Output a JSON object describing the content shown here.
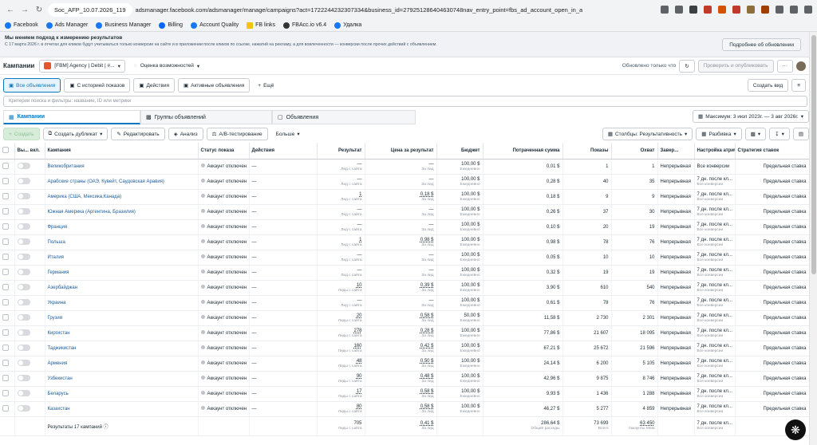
{
  "browser": {
    "tab_title": "Soc_AFP_10.07.2026_119",
    "url": "adsmanager.facebook.com/adsmanager/manage/campaigns?act=1722244232307334&business_id=279251286404630748nav_entry_point=fbs_ad_account_open_in_ads_manager_butto..."
  },
  "bookmarks": [
    "Facebook",
    "Ads Manager",
    "Business Manager",
    "Billing",
    "Account Quality",
    "FB links",
    "FBAcc.io v6.4",
    "Удалка"
  ],
  "notice": {
    "title": "Мы меняем подход к измерению результатов",
    "text": "С 17 марта 2026 г. в отчетах для кликов будут учитываться только конверсии на сайте и в приложении после кликов по ссылке, нажатий на рекламу, а для вовлеченности — конверсии после прочих действий с объявлением.",
    "button": "Подробнее об обновлении"
  },
  "header": {
    "title": "Кампании",
    "account": "[FBM] Agency | Debit | #...",
    "opportunity": "Оценка возможностей",
    "updated": "Обновлено только что",
    "review_publish": "Проверить и опубликовать",
    "more": "···"
  },
  "filters": {
    "all_ads": "Все объявления",
    "history": "С историей показов",
    "actions": "Действия",
    "active": "Активные объявления",
    "more": "Ещё",
    "create_view": "Создать вид"
  },
  "search": {
    "placeholder": "Критерии поиска и фильтры: название, ID или метрики"
  },
  "level_tabs": {
    "campaigns": "Кампании",
    "adsets": "Группы объявлений",
    "ads": "Объявления",
    "date_range": "Максимум: 3 июл 2023г. — 3 авг 2026г."
  },
  "actions": {
    "create": "Создать",
    "duplicate": "Создать дубликат",
    "edit": "Редактировать",
    "analysis": "Анализ",
    "ab_test": "A/B-тестирование",
    "more": "Больше",
    "columns": "Столбцы: Результативность",
    "breakdown": "Разбивка"
  },
  "columns": {
    "onoff": "Вы... вкл.",
    "campaign": "Кампания",
    "status": "Статус показа",
    "actions": "Действия",
    "results": "Результат",
    "cost_per_result": "Цена за результат",
    "budget": "Бюджет",
    "spent": "Потраченная сумма",
    "impressions": "Показы",
    "reach": "Охват",
    "end": "Завер...",
    "attribution": "Настройка атрибуции",
    "bid": "Стратегия ставок"
  },
  "labels": {
    "status": "Аккаунт отключен",
    "results_sub": "Лид с сайта",
    "results_sub_plural": "Лиды с сайта",
    "cpr_sub": "За лид",
    "budget_sub": "Ежедневно",
    "end_val": "Непрерывная",
    "attr_sub": "Все конверсии",
    "bid_val": "Предельная ставка",
    "attr_val": "7 дн. после кл..."
  },
  "rows": [
    {
      "name": "Великобритания",
      "results": "—",
      "cpr": "—",
      "budget": "100,00 $",
      "spent": "0,01 $",
      "imp": "1",
      "reach": "1",
      "attr": "Все конверсии"
    },
    {
      "name": "Арабские страны (ОАЭ, Кувейт, Саудовская Аравия)",
      "results": "—",
      "cpr": "—",
      "budget": "100,00 $",
      "spent": "0,28 $",
      "imp": "40",
      "reach": "35",
      "attr": "7 дн. после кл..."
    },
    {
      "name": "Америка (США, Мексика,Канада)",
      "results": "1",
      "cpr": "0,18 $",
      "budget": "100,00 $",
      "spent": "0,18 $",
      "imp": "9",
      "reach": "9",
      "attr": "7 дн. после кл..."
    },
    {
      "name": "Южная Америка (Аргентина, Бразилия)",
      "results": "—",
      "cpr": "—",
      "budget": "100,00 $",
      "spent": "0,26 $",
      "imp": "37",
      "reach": "30",
      "attr": "7 дн. после кл..."
    },
    {
      "name": "Франция",
      "results": "—",
      "cpr": "—",
      "budget": "100,00 $",
      "spent": "0,10 $",
      "imp": "20",
      "reach": "19",
      "attr": "7 дн. после кл..."
    },
    {
      "name": "Польша",
      "results": "1",
      "cpr": "0,98 $",
      "budget": "100,00 $",
      "spent": "0,98 $",
      "imp": "78",
      "reach": "76",
      "attr": "7 дн. после кл..."
    },
    {
      "name": "Италия",
      "results": "—",
      "cpr": "—",
      "budget": "100,00 $",
      "spent": "0,05 $",
      "imp": "10",
      "reach": "10",
      "attr": "7 дн. после кл..."
    },
    {
      "name": "Германия",
      "results": "—",
      "cpr": "—",
      "budget": "100,00 $",
      "spent": "0,32 $",
      "imp": "19",
      "reach": "19",
      "attr": "7 дн. после кл..."
    },
    {
      "name": "Азербайджан",
      "results": "10",
      "cpr": "0,39 $",
      "budget": "100,00 $",
      "spent": "3,90 $",
      "imp": "610",
      "reach": "540",
      "attr": "7 дн. после кл..."
    },
    {
      "name": "Украина",
      "results": "—",
      "cpr": "—",
      "budget": "100,00 $",
      "spent": "0,61 $",
      "imp": "78",
      "reach": "76",
      "attr": "7 дн. после кл..."
    },
    {
      "name": "Грузия",
      "results": "20",
      "cpr": "0,58 $",
      "budget": "50,00 $",
      "spent": "11,58 $",
      "imp": "2 730",
      "reach": "2 301",
      "attr": "7 дн. после кл..."
    },
    {
      "name": "Киргистан",
      "results": "278",
      "cpr": "0,28 $",
      "budget": "100,00 $",
      "spent": "77,86 $",
      "imp": "21 607",
      "reach": "18 095",
      "attr": "7 дн. после кл..."
    },
    {
      "name": "Таджикистан",
      "results": "160",
      "cpr": "0,42 $",
      "budget": "100,00 $",
      "spent": "67,21 $",
      "imp": "25 672",
      "reach": "21 596",
      "attr": "7 дн. после кл..."
    },
    {
      "name": "Армения",
      "results": "48",
      "cpr": "0,50 $",
      "budget": "100,00 $",
      "spent": "24,14 $",
      "imp": "6 200",
      "reach": "5 105",
      "attr": "7 дн. после кл..."
    },
    {
      "name": "Узбекистан",
      "results": "90",
      "cpr": "0,48 $",
      "budget": "100,00 $",
      "spent": "42,96 $",
      "imp": "9 875",
      "reach": "8 746",
      "attr": "7 дн. после кл..."
    },
    {
      "name": "Беларусь",
      "results": "17",
      "cpr": "0,58 $",
      "budget": "100,00 $",
      "spent": "9,93 $",
      "imp": "1 436",
      "reach": "1 288",
      "attr": "7 дн. после кл..."
    },
    {
      "name": "Казахстан",
      "results": "80",
      "cpr": "0,58 $",
      "budget": "100,00 $",
      "spent": "46,27 $",
      "imp": "5 277",
      "reach": "4 859",
      "attr": "7 дн. после кл..."
    }
  ],
  "totals": {
    "label": "Результаты 17 кампаний",
    "results": "705",
    "results_sub": "Лиды с сайта",
    "cpr": "0,41 $",
    "cpr_sub": "За лид",
    "spent": "286,64 $",
    "spent_sub": "Общие расходы",
    "imp": "73 699",
    "imp_sub": "Всего",
    "reach": "63 450",
    "reach_sub": "Аккаунты Meta",
    "attr": "7 дн. после кл...",
    "attr_sub": "Все конверсии"
  }
}
